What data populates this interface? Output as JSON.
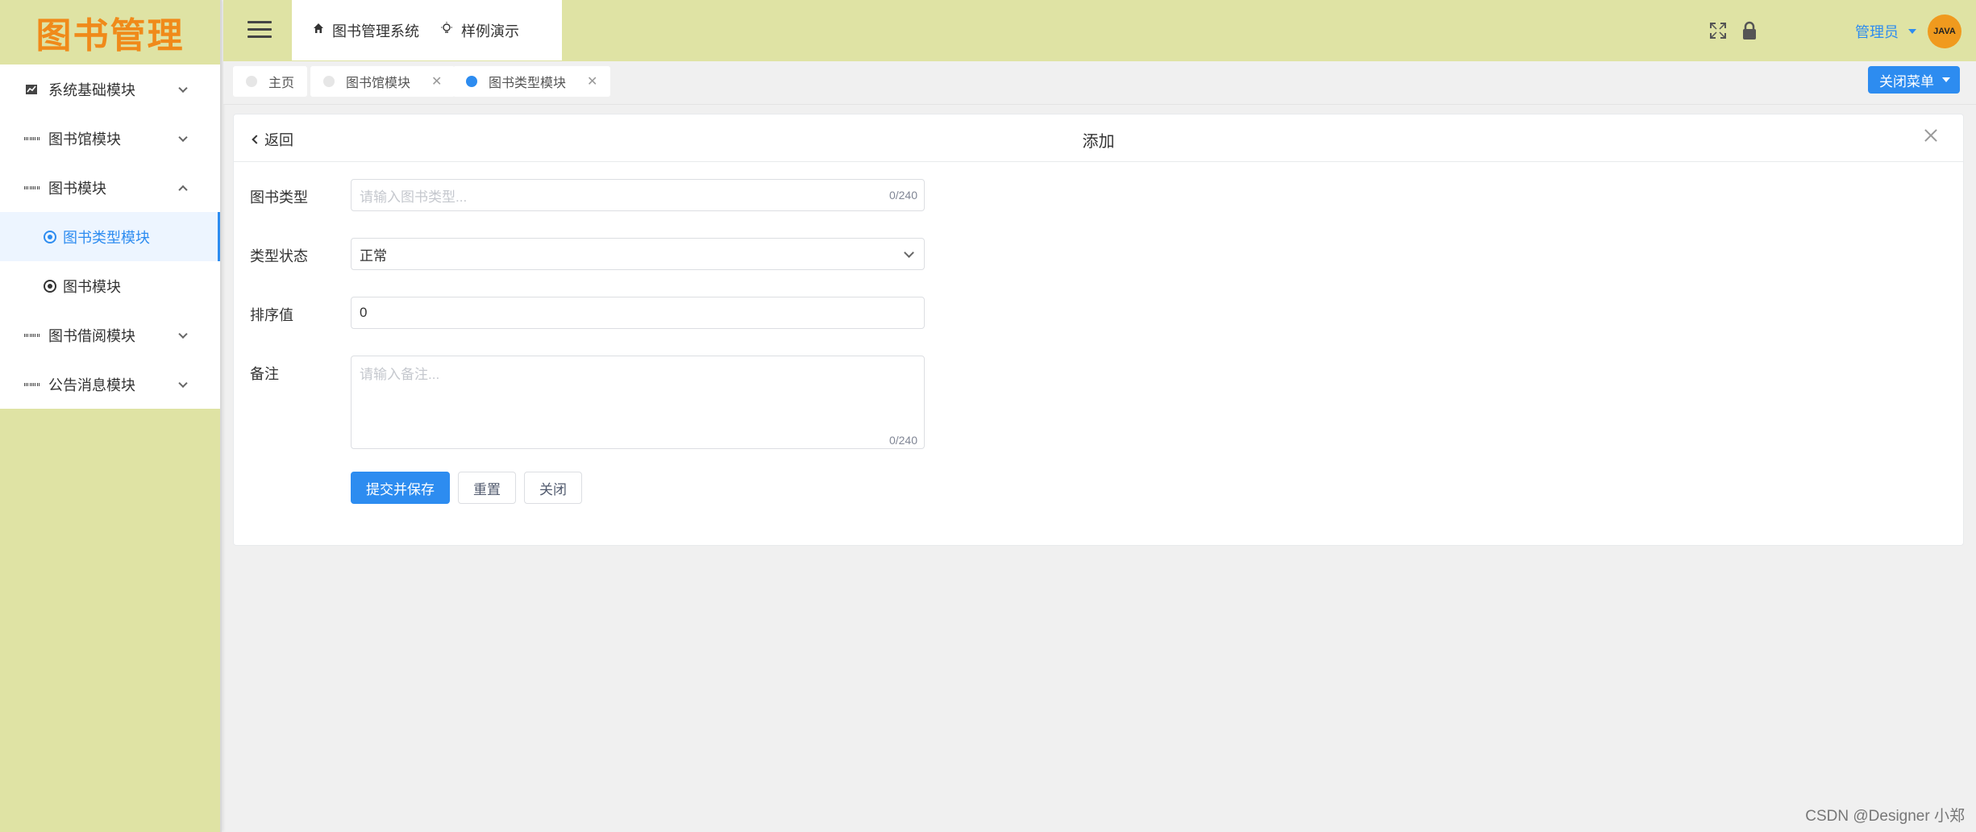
{
  "app": {
    "logo_text": "图书管理"
  },
  "sidebar": {
    "items": [
      {
        "label": "系统基础模块",
        "icon": "chart-icon",
        "expanded": false
      },
      {
        "label": "图书馆模块",
        "icon": "grid-icon",
        "expanded": false
      },
      {
        "label": "图书模块",
        "icon": "grid-icon",
        "expanded": true
      },
      {
        "label": "图书借阅模块",
        "icon": "grid-icon",
        "expanded": false
      },
      {
        "label": "公告消息模块",
        "icon": "grid-icon",
        "expanded": false
      }
    ],
    "sub_items": [
      {
        "label": "图书类型模块",
        "active": true
      },
      {
        "label": "图书模块",
        "active": false
      }
    ]
  },
  "header": {
    "nav": [
      {
        "label": "图书管理系统",
        "icon": "home-icon"
      },
      {
        "label": "样例演示",
        "icon": "bulb-icon"
      }
    ],
    "user_name": "管理员",
    "avatar_text": "JAVA"
  },
  "tabs": [
    {
      "label": "主页",
      "closable": false,
      "active": false
    },
    {
      "label": "图书馆模块",
      "closable": true,
      "active": false
    },
    {
      "label": "图书类型模块",
      "closable": true,
      "active": true
    }
  ],
  "close_menu_label": "关闭菜单",
  "form": {
    "back_label": "返回",
    "title": "添加",
    "fields": {
      "book_type": {
        "label": "图书类型",
        "placeholder": "请输入图书类型...",
        "value": "",
        "count": "0/240"
      },
      "status": {
        "label": "类型状态",
        "value": "正常"
      },
      "sort": {
        "label": "排序值",
        "value": "0"
      },
      "remark": {
        "label": "备注",
        "placeholder": "请输入备注...",
        "value": "",
        "count": "0/240"
      }
    },
    "buttons": {
      "submit": "提交并保存",
      "reset": "重置",
      "close": "关闭"
    }
  },
  "watermark": "CSDN @Designer 小郑",
  "colors": {
    "accent": "#2d8cf0",
    "sidebar_bg": "#dfe3a4",
    "logo": "#f08a1a"
  }
}
